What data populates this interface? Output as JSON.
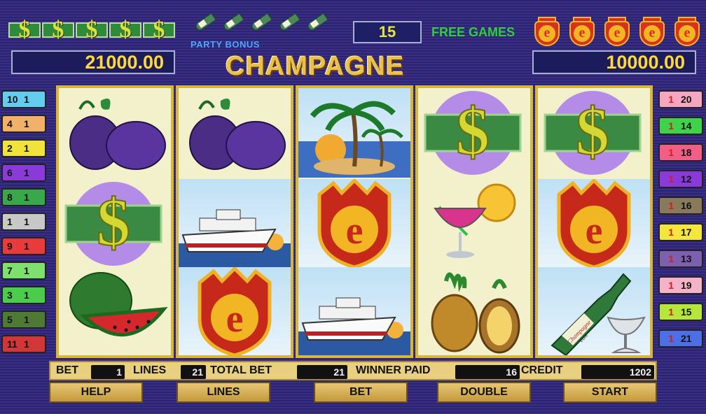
{
  "header": {
    "party_bonus_label": "PARTY BONUS",
    "free_games_count": "15",
    "free_games_label": "FREE GAMES",
    "title": "CHAMPAGNE",
    "left_amount": "21000.00",
    "right_amount": "10000.00"
  },
  "left_lines": [
    {
      "line": "10",
      "value": "1",
      "color": "#63cdf0"
    },
    {
      "line": "4",
      "value": "1",
      "color": "#f2b06b"
    },
    {
      "line": "2",
      "value": "1",
      "color": "#f1e33a"
    },
    {
      "line": "6",
      "value": "1",
      "color": "#8a3ad8"
    },
    {
      "line": "8",
      "value": "1",
      "color": "#39a84a"
    },
    {
      "line": "1",
      "value": "1",
      "color": "#c8c8c8"
    },
    {
      "line": "9",
      "value": "1",
      "color": "#e83b3b"
    },
    {
      "line": "7",
      "value": "1",
      "color": "#7de06f"
    },
    {
      "line": "3",
      "value": "1",
      "color": "#4ccc4c"
    },
    {
      "line": "5",
      "value": "1",
      "color": "#4e7a35"
    },
    {
      "line": "11",
      "value": "1",
      "color": "#d23636"
    }
  ],
  "right_lines": [
    {
      "line": "20",
      "value": "1",
      "color": "#f7a6c0"
    },
    {
      "line": "14",
      "value": "1",
      "color": "#3fd24a"
    },
    {
      "line": "18",
      "value": "1",
      "color": "#f25f86"
    },
    {
      "line": "12",
      "value": "1",
      "color": "#8a3ad8"
    },
    {
      "line": "16",
      "value": "1",
      "color": "#8a7a5c"
    },
    {
      "line": "17",
      "value": "1",
      "color": "#f4e63a"
    },
    {
      "line": "13",
      "value": "1",
      "color": "#7c5fae"
    },
    {
      "line": "19",
      "value": "1",
      "color": "#f5b3c8"
    },
    {
      "line": "15",
      "value": "1",
      "color": "#b6e63a"
    },
    {
      "line": "21",
      "value": "1",
      "color": "#4c6ee6"
    }
  ],
  "reels": [
    [
      "plum-icon",
      "dollar-icon",
      "watermelon-icon"
    ],
    [
      "plum-icon",
      "cruise-ship-icon",
      "e-shield-icon"
    ],
    [
      "palm-island-icon",
      "e-shield-icon",
      "cruise-ship-icon"
    ],
    [
      "dollar-icon",
      "cocktail-icon",
      "pineapple-icon"
    ],
    [
      "dollar-icon",
      "e-shield-icon",
      "champagne-bottle-icon"
    ]
  ],
  "bottle_label": "Champagne",
  "bottle_sublabel": "LUX",
  "status": {
    "bet_label": "BET",
    "bet_value": "1",
    "lines_label": "LINES",
    "lines_value": "21",
    "total_bet_label": "TOTAL BET",
    "total_bet_value": "21",
    "winner_paid_label": "WINNER PAID",
    "winner_paid_value": "16",
    "credit_label": "CREDIT",
    "credit_value": "1202"
  },
  "buttons": {
    "help": "HELP",
    "lines": "LINES",
    "bet": "BET",
    "double": "DOUBLE",
    "start": "START"
  },
  "colors": {
    "background": "#3a2f85",
    "reel_border": "#d8b63a",
    "amount_text": "#ffd93a",
    "free_games_green": "#2fcf3a"
  }
}
